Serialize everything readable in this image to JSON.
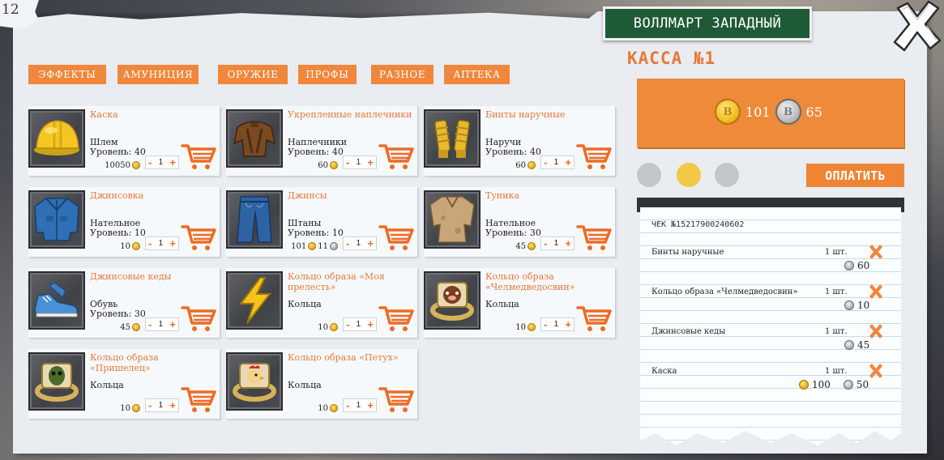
{
  "corner_note": "12",
  "store": {
    "name": "ВОЛЛМАРТ ЗАПАДНЫЙ"
  },
  "tabs": [
    {
      "label": "ЭФФЕКТЫ"
    },
    {
      "label": "АМУНИЦИЯ"
    },
    {
      "label": "ОРУЖИЕ"
    },
    {
      "label": "ПРОФЫ"
    },
    {
      "label": "РАЗНОЕ"
    },
    {
      "label": "АПТЕКА"
    }
  ],
  "items": [
    {
      "name": "Каска",
      "slot": "Шлем",
      "level": "Уровень: 40",
      "price_gold": "10050",
      "price_silver": "",
      "qty": "1",
      "icon": "helmet-icon"
    },
    {
      "name": "Укрепленные наплечники",
      "slot": "Наплечники",
      "level": "Уровень: 40",
      "price_gold": "60",
      "price_silver": "",
      "qty": "1",
      "icon": "shoulder-pads-icon"
    },
    {
      "name": "Бинты наручные",
      "slot": "Наручи",
      "level": "Уровень: 40",
      "price_gold": "60",
      "price_silver": "",
      "qty": "1",
      "icon": "wrist-bandages-icon"
    },
    {
      "name": "Джинсовка",
      "slot": "Нательное",
      "level": "Уровень: 10",
      "price_gold": "10",
      "price_silver": "",
      "qty": "1",
      "icon": "denim-jacket-icon"
    },
    {
      "name": "Джинсы",
      "slot": "Штаны",
      "level": "Уровень: 10",
      "price_gold": "101",
      "price_silver": "11",
      "qty": "1",
      "icon": "jeans-icon"
    },
    {
      "name": "Туника",
      "slot": "Нательное",
      "level": "Уровень: 30",
      "price_gold": "45",
      "price_silver": "",
      "qty": "1",
      "icon": "tunic-icon"
    },
    {
      "name": "Джинсовые кеды",
      "slot": "Обувь",
      "level": "Уровень: 30",
      "price_gold": "45",
      "price_silver": "",
      "qty": "1",
      "icon": "sneakers-icon"
    },
    {
      "name": "Кольцо образа «Моя прелесть»",
      "slot": "Кольца",
      "level": "",
      "price_gold": "10",
      "price_silver": "",
      "qty": "1",
      "icon": "lightning-icon"
    },
    {
      "name": "Кольцо образа «Челмедведосвин»",
      "slot": "Кольца",
      "level": "",
      "price_gold": "10",
      "price_silver": "",
      "qty": "1",
      "icon": "ring-bearpig-icon"
    },
    {
      "name": "Кольцо образа «Пришелец»",
      "slot": "Кольца",
      "level": "",
      "price_gold": "10",
      "price_silver": "",
      "qty": "1",
      "icon": "ring-alien-icon"
    },
    {
      "name": "Кольцо образа «Петух»",
      "slot": "Кольца",
      "level": "",
      "price_gold": "10",
      "price_silver": "",
      "qty": "1",
      "icon": "ring-rooster-icon"
    }
  ],
  "register": {
    "title": "КАССА №1",
    "balance_gold": "101",
    "balance_silver": "65",
    "pay_label": "ОПЛАТИТЬ",
    "active_dot": 1
  },
  "receipt": {
    "number": "ЧЕК №15217900240602",
    "lines": [
      {
        "name": "Бинты наручные",
        "qty": "1 шт.",
        "gold": "",
        "silver": "60"
      },
      {
        "name": "Кольцо образа «Челмедведосвин»",
        "qty": "1 шт.",
        "gold": "",
        "silver": "10"
      },
      {
        "name": "Джинсовые кеды",
        "qty": "1 шт.",
        "gold": "",
        "silver": "45"
      },
      {
        "name": "Каска",
        "qty": "1 шт.",
        "gold": "100",
        "silver": "50"
      }
    ]
  },
  "colors": {
    "accent": "#ef8434",
    "banner": "#1f5a36",
    "sheet": "#e9edf1"
  }
}
